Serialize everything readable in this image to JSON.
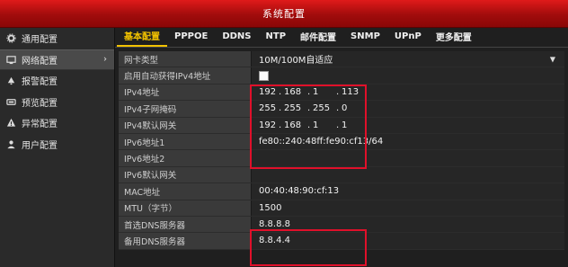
{
  "window": {
    "title": "系统配置"
  },
  "sidebar": {
    "items": [
      {
        "label": "通用配置",
        "icon": "gear-icon"
      },
      {
        "label": "网络配置",
        "icon": "network-icon",
        "active": true
      },
      {
        "label": "报警配置",
        "icon": "alarm-icon"
      },
      {
        "label": "预览配置",
        "icon": "preview-icon"
      },
      {
        "label": "异常配置",
        "icon": "warning-icon"
      },
      {
        "label": "用户配置",
        "icon": "user-icon"
      }
    ],
    "chevron": "›"
  },
  "tabs": [
    {
      "label": "基本配置",
      "active": true
    },
    {
      "label": "PPPOE"
    },
    {
      "label": "DDNS"
    },
    {
      "label": "NTP"
    },
    {
      "label": "邮件配置"
    },
    {
      "label": "SNMP"
    },
    {
      "label": "UPnP"
    },
    {
      "label": "更多配置"
    }
  ],
  "fields": {
    "nic_type": {
      "label": "网卡类型",
      "value": "10M/100M自适应"
    },
    "dhcp": {
      "label": "启用自动获得IPv4地址",
      "checked": false
    },
    "ipv4_addr": {
      "label": "IPv4地址",
      "octets": [
        "192",
        "168",
        "1",
        "113"
      ]
    },
    "ipv4_mask": {
      "label": "IPv4子网掩码",
      "octets": [
        "255",
        "255",
        "255",
        "0"
      ]
    },
    "ipv4_gw": {
      "label": "IPv4默认网关",
      "octets": [
        "192",
        "168",
        "1",
        "1"
      ]
    },
    "ipv6_addr1": {
      "label": "IPv6地址1",
      "value": "fe80::240:48ff:fe90:cf13/64"
    },
    "ipv6_addr2": {
      "label": "IPv6地址2",
      "value": ""
    },
    "ipv6_gw": {
      "label": "IPv6默认网关",
      "value": ""
    },
    "mac": {
      "label": "MAC地址",
      "value": "00:40:48:90:cf:13"
    },
    "mtu": {
      "label": "MTU（字节）",
      "value": "1500"
    },
    "dns1": {
      "label": "首选DNS服务器",
      "value": "8.8.8.8"
    },
    "dns2": {
      "label": "备用DNS服务器",
      "value": "8.8.4.4"
    }
  },
  "colors": {
    "title_red": "#c41212",
    "active_tab": "#f2c200",
    "highlight": "#e0102a"
  }
}
